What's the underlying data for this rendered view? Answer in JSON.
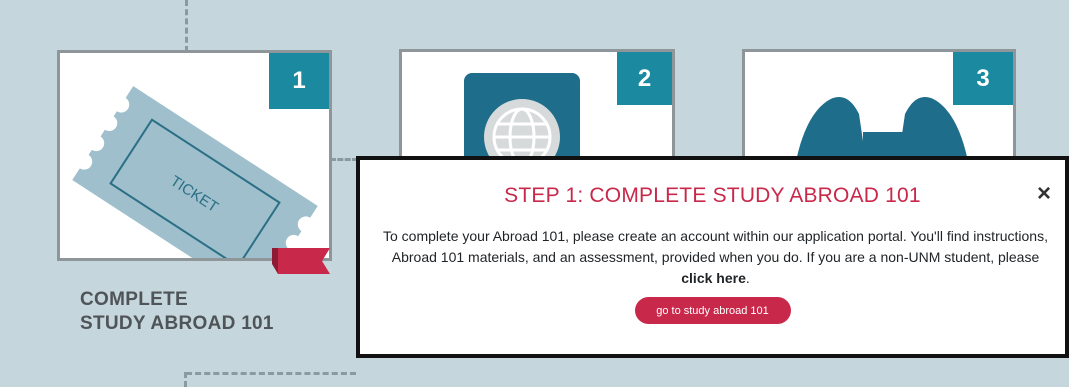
{
  "steps": [
    {
      "number": "1",
      "label_line1": "COMPLETE",
      "label_line2": "STUDY ABROAD 101",
      "icon": "ticket-icon",
      "icon_text": "TICKET"
    },
    {
      "number": "2",
      "icon": "passport-icon"
    },
    {
      "number": "3",
      "icon": "binoculars-icon"
    }
  ],
  "modal": {
    "title": "STEP 1: COMPLETE STUDY ABROAD 101",
    "close_icon": "×",
    "body_text": "To complete your Abroad 101, please create an account within our application portal. You'll find instructions, Abroad 101 materials, and an assessment, provided when you do. If you are a non-UNM student, please ",
    "link_text": "click here",
    "body_end": ".",
    "button_label": "go to study abroad 101"
  },
  "colors": {
    "background": "#c6d6dd",
    "badge": "#1b8aa1",
    "accent": "#c8284a",
    "ticket": "#9ebfcb",
    "icon_dark": "#1e6d8a"
  }
}
